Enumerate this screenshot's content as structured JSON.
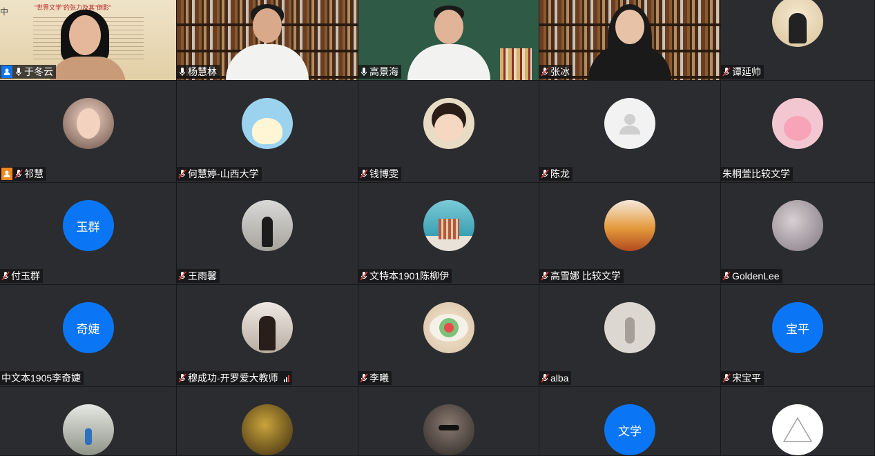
{
  "participants": [
    {
      "name": "于冬云",
      "kind": "video",
      "host": true,
      "mic": "on"
    },
    {
      "name": "杨慧林",
      "kind": "video",
      "mic": "on"
    },
    {
      "name": "高景海",
      "kind": "video",
      "mic": "on"
    },
    {
      "name": "张冰",
      "kind": "video",
      "mic": "muted"
    },
    {
      "name": "谭延帅",
      "kind": "avatar",
      "mic": "muted"
    },
    {
      "name": "祁慧",
      "kind": "avatar",
      "cohost": true,
      "mic": "muted"
    },
    {
      "name": "何慧婷-山西大学",
      "kind": "avatar",
      "mic": "muted"
    },
    {
      "name": "钱博雯",
      "kind": "avatar",
      "mic": "muted"
    },
    {
      "name": "陈龙",
      "kind": "avatar",
      "mic": "muted"
    },
    {
      "name": "朱桐萱比较文学",
      "kind": "avatar",
      "mic": "none"
    },
    {
      "name": "付玉群",
      "kind": "text",
      "avatar_text": "玉群",
      "mic": "muted"
    },
    {
      "name": "王雨馨",
      "kind": "avatar",
      "mic": "muted"
    },
    {
      "name": "文特本1901陈柳伊",
      "kind": "avatar",
      "mic": "muted"
    },
    {
      "name": "高雪娜 比较文学",
      "kind": "avatar",
      "mic": "muted"
    },
    {
      "name": "GoldenLee",
      "kind": "avatar",
      "mic": "muted"
    },
    {
      "name": "中文本1905李奇婕",
      "kind": "text",
      "avatar_text": "奇婕",
      "mic": "none"
    },
    {
      "name": "穆成功-开罗爱大教师",
      "kind": "avatar",
      "mic": "muted",
      "signal": true
    },
    {
      "name": "李曦",
      "kind": "avatar",
      "mic": "muted"
    },
    {
      "name": "alba",
      "kind": "avatar",
      "mic": "muted"
    },
    {
      "name": "宋宝平",
      "kind": "text",
      "avatar_text": "宝平",
      "mic": "muted"
    },
    {
      "name": "",
      "kind": "avatar",
      "mic": "none"
    },
    {
      "name": "",
      "kind": "avatar",
      "mic": "none"
    },
    {
      "name": "",
      "kind": "avatar",
      "mic": "none"
    },
    {
      "name": "",
      "kind": "text",
      "avatar_text": "文学",
      "mic": "none"
    },
    {
      "name": "",
      "kind": "avatar",
      "mic": "none"
    }
  ],
  "slide": {
    "title": "“世界文学”的张力及其“倒影”",
    "left_char": "中"
  },
  "colors": {
    "accent": "#0b76f5",
    "cohost": "#f08a1e",
    "tile_bg": "#2b2c2f"
  }
}
